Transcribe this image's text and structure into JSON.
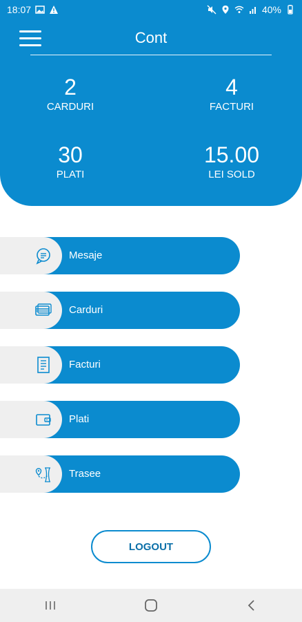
{
  "status_bar": {
    "time": "18:07",
    "battery": "40%"
  },
  "header": {
    "title": "Cont",
    "stats": {
      "cards": {
        "value": "2",
        "label": "CARDURI"
      },
      "bills": {
        "value": "4",
        "label": "FACTURI"
      },
      "payments": {
        "value": "30",
        "label": "PLATI"
      },
      "balance": {
        "value": "15.00",
        "label": "LEI SOLD"
      }
    }
  },
  "menu": [
    {
      "label": "Mesaje",
      "icon": "chat-bubble-icon"
    },
    {
      "label": "Carduri",
      "icon": "credit-card-icon"
    },
    {
      "label": "Facturi",
      "icon": "invoice-icon"
    },
    {
      "label": "Plati",
      "icon": "wallet-icon"
    },
    {
      "label": "Trasee",
      "icon": "route-map-icon"
    }
  ],
  "logout_label": "LOGOUT",
  "colors": {
    "primary": "#0b8bcf",
    "icon_bg": "#efefef",
    "nav_bg": "#efefef"
  }
}
